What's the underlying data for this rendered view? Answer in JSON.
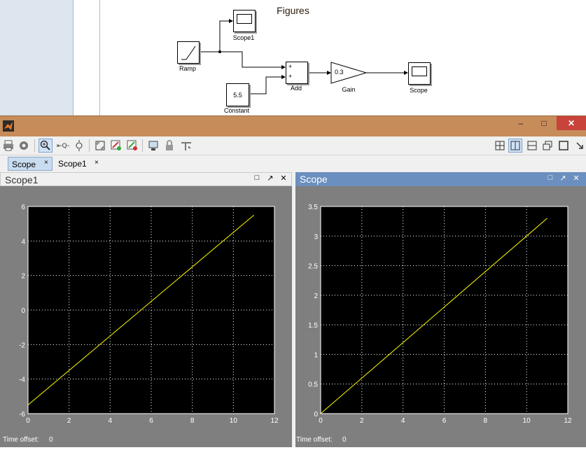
{
  "simulink": {
    "blocks": {
      "ramp": "Ramp",
      "scope1": "Scope1",
      "add": "Add",
      "add_port1": "+",
      "add_port2": "+",
      "gain": "Gain",
      "gain_value": "0.3",
      "scope": "Scope",
      "constant": "Constant",
      "constant_value": "5.5"
    }
  },
  "window": {
    "title": "Figures",
    "buttons": {
      "minimize": "–",
      "maximize": "□",
      "close": "✕"
    }
  },
  "toolbar": {
    "icons": [
      "print-icon",
      "settings-icon",
      "zoom-in-icon",
      "zoom-x-icon",
      "zoom-y-icon",
      "autoscale-icon",
      "axes-settings-icon",
      "restore-axes-icon",
      "save-axes-icon",
      "lock-icon",
      "float-icon"
    ],
    "layout_icons": [
      "tile-icon",
      "left-right-icon",
      "top-bottom-icon",
      "float-window-icon",
      "single-icon",
      "dock-icon"
    ]
  },
  "tabs": [
    {
      "label": "Scope",
      "close": "×",
      "active": true
    },
    {
      "label": "Scope1",
      "close": "×",
      "active": false
    }
  ],
  "panels": {
    "left": {
      "title": "Scope1",
      "time_offset_label": "Time offset:",
      "time_offset_value": "0"
    },
    "right": {
      "title": "Scope",
      "time_offset_label": "Time offset:",
      "time_offset_value": "0"
    }
  },
  "chart_data": [
    {
      "type": "line",
      "xlim": [
        0,
        12
      ],
      "ylim": [
        -6,
        6
      ],
      "xticks": [
        0,
        2,
        4,
        6,
        8,
        10,
        12
      ],
      "yticks": [
        -6,
        -4,
        -2,
        0,
        2,
        4,
        6
      ],
      "grid": true,
      "series": [
        {
          "x": [
            0,
            11
          ],
          "y": [
            -5.5,
            5.5
          ],
          "color": "#ffff00"
        }
      ],
      "background": "#000000"
    },
    {
      "type": "line",
      "xlim": [
        0,
        12
      ],
      "ylim": [
        0,
        3.5
      ],
      "xticks": [
        0,
        2,
        4,
        6,
        8,
        10,
        12
      ],
      "yticks": [
        0,
        0.5,
        1,
        1.5,
        2,
        2.5,
        3,
        3.5
      ],
      "grid": true,
      "series": [
        {
          "x": [
            0,
            11
          ],
          "y": [
            0,
            3.3
          ],
          "color": "#ffff00"
        }
      ],
      "background": "#000000"
    }
  ]
}
